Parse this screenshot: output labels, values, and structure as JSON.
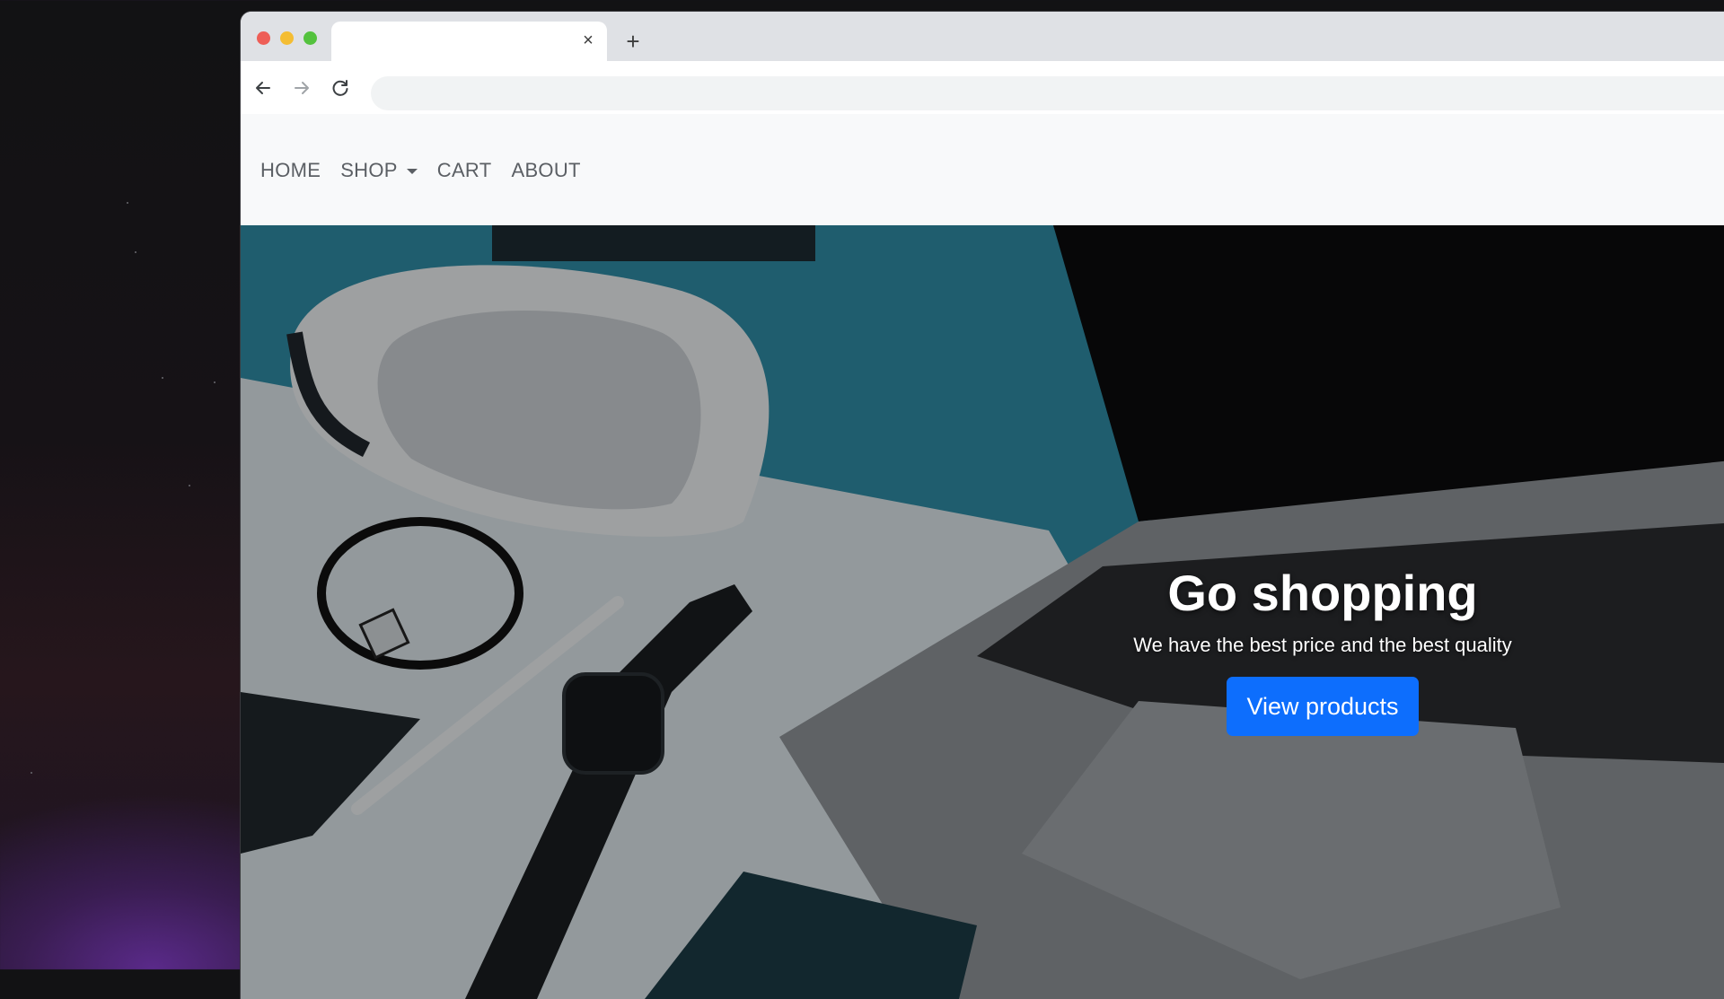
{
  "browser": {
    "tab": {
      "title": "",
      "close_glyph": "×"
    },
    "new_tab_glyph": "+",
    "toolbar": {
      "back_icon": "arrow-left-icon",
      "forward_icon": "arrow-right-icon",
      "reload_icon": "reload-icon"
    },
    "address_bar": {
      "value": "",
      "placeholder": ""
    }
  },
  "site": {
    "nav": {
      "items": [
        {
          "label": "HOME"
        },
        {
          "label": "SHOP",
          "has_dropdown": true
        },
        {
          "label": "CART"
        },
        {
          "label": "ABOUT"
        }
      ]
    },
    "hero": {
      "title": "Go shopping",
      "subtitle": "We have the best price and the best quality",
      "button_label": "View products"
    }
  },
  "colors": {
    "primary_button": "#0d6efd",
    "navbar_bg": "#f8f9fa",
    "nav_link": "#5b5f64",
    "tabstrip_bg": "#dfe1e5"
  }
}
